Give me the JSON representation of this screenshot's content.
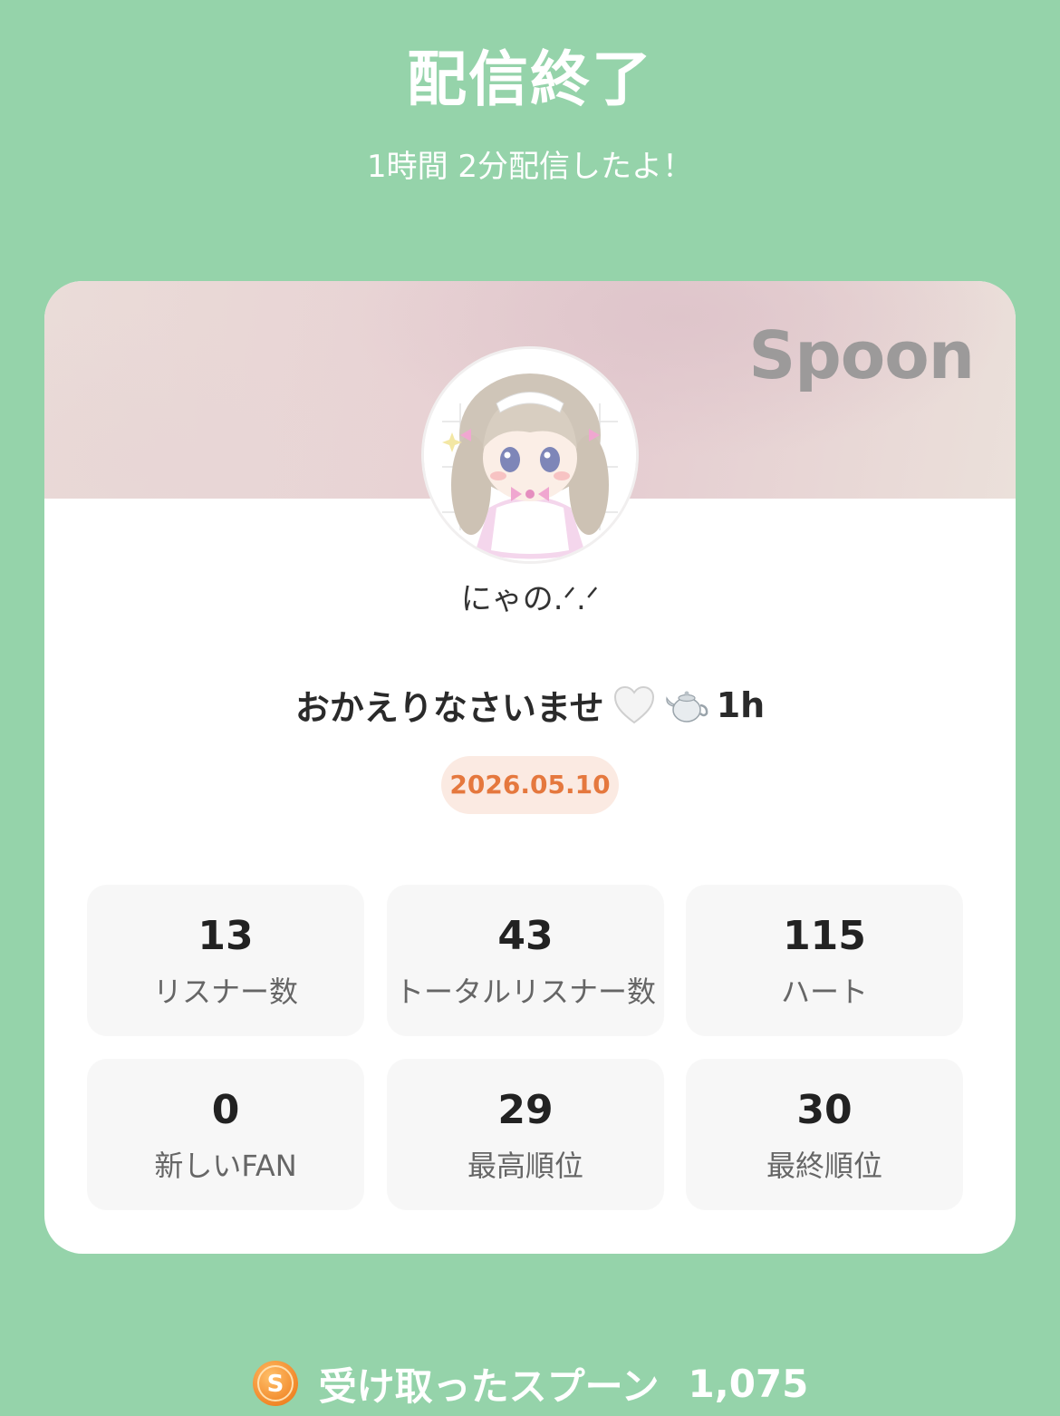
{
  "header": {
    "title": "配信終了",
    "duration_message": "1時間 2分配信したよ！"
  },
  "card": {
    "brand": "Spoon",
    "username": "にゃの.ᐟ.ᐟ",
    "broadcast_title": "おかえりなさいませ",
    "broadcast_title_suffix": "1h",
    "title_emojis": [
      "white-heart-icon",
      "teapot-icon"
    ],
    "date": "2026.05.10",
    "stats": [
      {
        "value": "13",
        "label": "リスナー数"
      },
      {
        "value": "43",
        "label": "トータルリスナー数"
      },
      {
        "value": "115",
        "label": "ハート"
      },
      {
        "value": "0",
        "label": "新しいFAN"
      },
      {
        "value": "29",
        "label": "最高順位"
      },
      {
        "value": "30",
        "label": "最終順位"
      }
    ]
  },
  "footer": {
    "label": "受け取ったスプーン",
    "value": "1,075",
    "icon": "spoon-coin-icon"
  },
  "colors": {
    "background": "#95d3aa",
    "date_badge_text": "#e5783e",
    "date_badge_bg": "#fbeae2",
    "coin": "#f08a2a"
  }
}
